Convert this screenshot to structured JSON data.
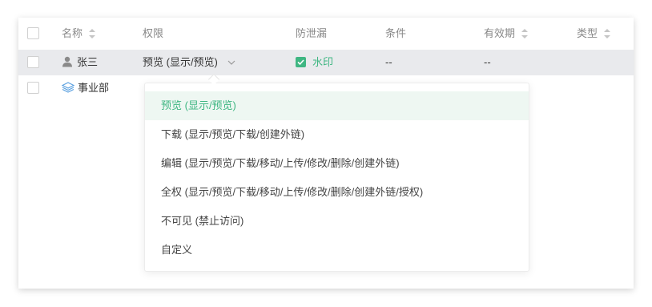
{
  "table": {
    "headers": {
      "name": "名称",
      "permission": "权限",
      "leak_prevention": "防泄漏",
      "condition": "条件",
      "expiry": "有效期",
      "type": "类型"
    },
    "rows": [
      {
        "name": "张三",
        "icon": "user-icon",
        "permission": "预览 (显示/预览)",
        "leak_checked": true,
        "leak_label": "水印",
        "condition": "--",
        "expiry": "--",
        "selected": true
      },
      {
        "name": "事业部",
        "icon": "group-icon",
        "selected": false
      }
    ]
  },
  "dropdown": {
    "options": [
      "预览 (显示/预览)",
      "下载 (显示/预览/下载/创建外链)",
      "编辑 (显示/预览/下载/移动/上传/修改/删除/创建外链)",
      "全权 (显示/预览/下载/移动/上传/修改/删除/创建外链/授权)",
      "不可见 (禁止访问)",
      "自定义"
    ],
    "selected_index": 0
  },
  "colors": {
    "accent": "#3fb682",
    "selected_row": "#e9eaed",
    "selected_option": "#eef7f2"
  }
}
